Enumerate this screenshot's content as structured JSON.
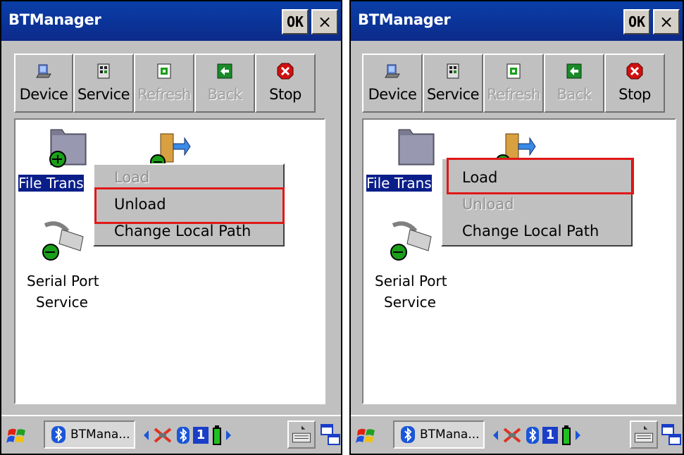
{
  "screens": [
    {
      "title": "BTManager",
      "ok_label": "OK",
      "close_label": "×",
      "toolbar": [
        {
          "label": "Device",
          "icon": "device-icon",
          "enabled": true
        },
        {
          "label": "Service",
          "icon": "service-icon",
          "enabled": true
        },
        {
          "label": "Refresh",
          "icon": "refresh-icon",
          "enabled": false
        },
        {
          "label": "Back",
          "icon": "back-icon",
          "enabled": false
        },
        {
          "label": "Stop",
          "icon": "stop-icon",
          "enabled": true
        }
      ],
      "items": [
        {
          "label": "File Trans",
          "icon": "folder-icon"
        },
        {
          "label": "",
          "icon": "door-exit-icon"
        },
        {
          "label": "Serial Port\nService",
          "icon": "serial-plug-icon"
        }
      ],
      "menu": [
        {
          "label": "Load",
          "enabled": false
        },
        {
          "label": "Unload",
          "enabled": true
        },
        {
          "label": "Change Local Path",
          "enabled": true
        }
      ],
      "highlighted_item": "Unload",
      "taskbar": {
        "task_label": "BTMana...",
        "battery": "1"
      }
    },
    {
      "title": "BTManager",
      "ok_label": "OK",
      "close_label": "×",
      "toolbar": [
        {
          "label": "Device",
          "icon": "device-icon",
          "enabled": true
        },
        {
          "label": "Service",
          "icon": "service-icon",
          "enabled": true
        },
        {
          "label": "Refresh",
          "icon": "refresh-icon",
          "enabled": false
        },
        {
          "label": "Back",
          "icon": "back-icon",
          "enabled": false
        },
        {
          "label": "Stop",
          "icon": "stop-icon",
          "enabled": true
        }
      ],
      "items": [
        {
          "label": "File Trans",
          "icon": "folder-icon"
        },
        {
          "label": "",
          "icon": "door-exit-icon"
        },
        {
          "label": "Serial Port\nService",
          "icon": "serial-plug-icon"
        }
      ],
      "menu": [
        {
          "label": "Load",
          "enabled": true
        },
        {
          "label": "Unload",
          "enabled": false
        },
        {
          "label": "Change Local Path",
          "enabled": true
        }
      ],
      "highlighted_item": "Load",
      "taskbar": {
        "task_label": "BTMana...",
        "battery": "1"
      }
    }
  ],
  "colors": {
    "titlebar": "#0a3fa8",
    "highlight": "#e01818",
    "selection": "#0a1e8a"
  }
}
